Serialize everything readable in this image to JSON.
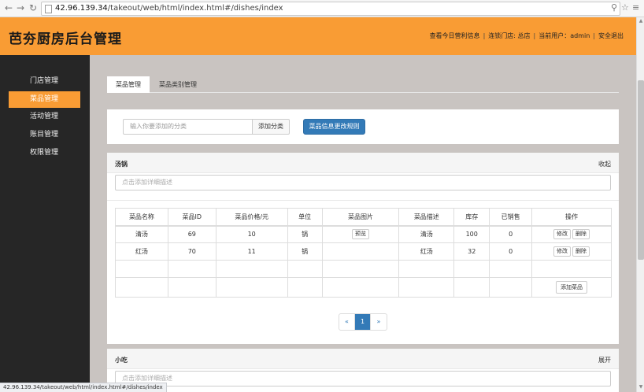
{
  "browser": {
    "url_host": "42.96.139.34",
    "url_path": "/takeout/web/html/index.html#/dishes/index",
    "status_url": "42.96.139.34/takeout/web/html/index.html#/dishes/index"
  },
  "header": {
    "brand": "芭夯厨房后台管理",
    "link_earnings": "查看今日营利信息",
    "store_label": "连锁门店: 总店",
    "user_label": "当前用户：admin",
    "logout": "安全退出",
    "sep": "|"
  },
  "sidebar": {
    "items": [
      {
        "label": "门店管理"
      },
      {
        "label": "菜品管理"
      },
      {
        "label": "活动管理"
      },
      {
        "label": "账目管理"
      },
      {
        "label": "权限管理"
      }
    ]
  },
  "tabs": [
    {
      "label": "菜品管理"
    },
    {
      "label": "菜品类别管理"
    }
  ],
  "toolbar": {
    "category_placeholder": "输入你要添加的分类",
    "add_category": "添加分类",
    "rules_button": "菜品信息更改规则"
  },
  "groups": [
    {
      "title": "汤锅",
      "toggle": "收起",
      "desc_placeholder": "点击添加详细描述",
      "columns": [
        "菜品名称",
        "菜品ID",
        "菜品价格/元",
        "单位",
        "菜品图片",
        "菜品描述",
        "库存",
        "已销售",
        "操作"
      ],
      "rows": [
        {
          "name": "清汤",
          "id": "69",
          "price": "10",
          "unit": "锅",
          "image_btn": "预览",
          "desc": "清汤",
          "stock": "100",
          "sold": "0",
          "edit": "修改",
          "del": "删除"
        },
        {
          "name": "红汤",
          "id": "70",
          "price": "11",
          "unit": "锅",
          "image_btn": "",
          "desc": "红汤",
          "stock": "32",
          "sold": "0",
          "edit": "修改",
          "del": "删除"
        }
      ],
      "add_dish": "添加菜品",
      "pager": {
        "prev": "«",
        "current": "1",
        "next": "»"
      }
    },
    {
      "title": "小吃",
      "toggle": "展开",
      "desc_placeholder": "点击添加详细描述"
    }
  ]
}
